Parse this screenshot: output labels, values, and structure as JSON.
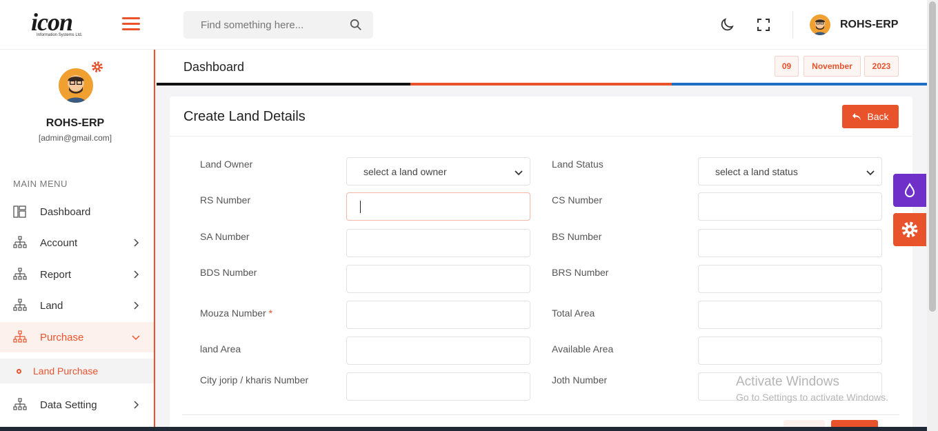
{
  "brand": {
    "logo_text": "icon",
    "logo_sub": "Information Systems Ltd."
  },
  "topbar": {
    "search_placeholder": "Find something here...",
    "user_name": "ROHS-ERP"
  },
  "sidebar": {
    "user_name": "ROHS-ERP",
    "user_email": "[admin@gmail.com]",
    "menu_title": "MAIN MENU",
    "items": [
      {
        "label": "Dashboard",
        "icon": "dashboard-icon"
      },
      {
        "label": "Account",
        "icon": "sitemap-icon"
      },
      {
        "label": "Report",
        "icon": "sitemap-icon"
      },
      {
        "label": "Land",
        "icon": "sitemap-icon"
      },
      {
        "label": "Purchase",
        "icon": "sitemap-icon",
        "active": true
      },
      {
        "label": "Data Setting",
        "icon": "sitemap-icon"
      }
    ],
    "sub_item": "Land Purchase"
  },
  "page": {
    "title": "Dashboard",
    "date": {
      "day": "09",
      "month": "November",
      "year": "2023"
    }
  },
  "form": {
    "title": "Create Land Details",
    "back_label": "Back",
    "fields": {
      "land_owner": {
        "label": "Land Owner",
        "value": "select a land owner"
      },
      "land_status": {
        "label": "Land Status",
        "value": "select a land status"
      },
      "rs_number": {
        "label": "RS Number"
      },
      "cs_number": {
        "label": "CS Number"
      },
      "sa_number": {
        "label": "SA Number"
      },
      "bs_number": {
        "label": "BS Number"
      },
      "bds_number": {
        "label": "BDS Number"
      },
      "brs_number": {
        "label": "BRS Number"
      },
      "mouza_number": {
        "label": "Mouza Number",
        "required": "*"
      },
      "total_area": {
        "label": "Total Area"
      },
      "land_area": {
        "label": "land Area"
      },
      "available_area": {
        "label": "Available Area"
      },
      "city_jorip": {
        "label": "City jorip / kharis Number"
      },
      "joth_number": {
        "label": "Joth Number"
      }
    }
  },
  "watermark": {
    "line1": "Activate Windows",
    "line2": "Go to Settings to activate Windows."
  },
  "colors": {
    "accent": "#e8532c",
    "purple": "#6f2fc9",
    "blue": "#1e6fc4",
    "dark": "#111111"
  }
}
